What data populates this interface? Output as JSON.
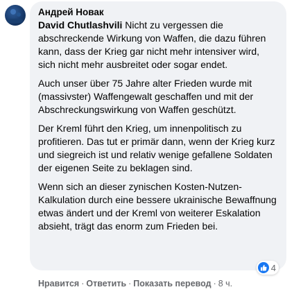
{
  "comment": {
    "author": "Андрей Новак",
    "mention": "David Chutlashvili",
    "paragraphs": [
      " Nicht zu vergessen die abschreckende Wirkung von Waffen, die dazu führen kann, dass der Krieg gar nicht mehr intensiver wird, sich nicht mehr ausbreitet oder sogar endet.",
      "Auch unser über 75 Jahre alter Frieden wurde mit (massivster) Waffengewalt geschaffen und mit der Abschreckungswirkung von Waffen geschützt.",
      "Der Kreml führt den Krieg, um innenpolitisch zu profitieren. Das tut er primär dann, wenn der Krieg kurz und siegreich ist und relativ wenige gefallene Soldaten der eigenen Seite zu beklagen sind.",
      "Wenn sich an dieser zynischen Kosten-Nutzen-Kalkulation durch eine bessere ukrainische Bewaffnung etwas ändert und der Kreml von weiterer Eskalation absieht, trägt das enorm zum Frieden bei."
    ],
    "reaction_count": "4",
    "reaction_icon": "like-icon",
    "accent_color": "#1877f2"
  },
  "actions": {
    "like_label": "Нравится",
    "reply_label": "Ответить",
    "translate_label": "Показать перевод",
    "separator": "·",
    "time": "8 ч."
  }
}
